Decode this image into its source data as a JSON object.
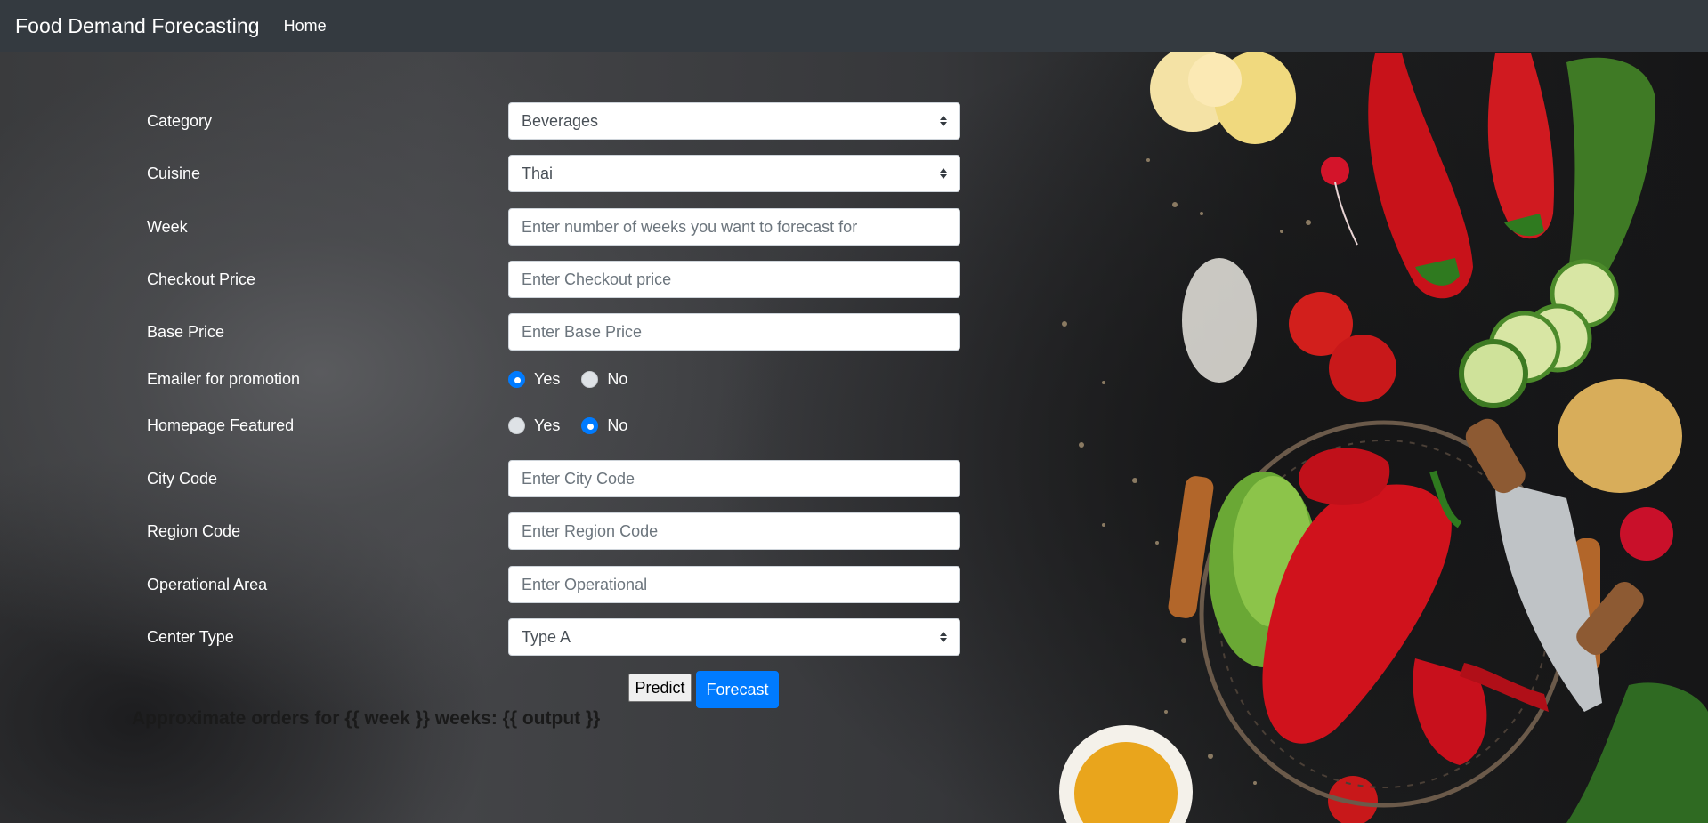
{
  "navbar": {
    "brand": "Food Demand Forecasting",
    "home": "Home"
  },
  "form": {
    "category": {
      "label": "Category",
      "value": "Beverages"
    },
    "cuisine": {
      "label": "Cuisine",
      "value": "Thai"
    },
    "week": {
      "label": "Week",
      "placeholder": "Enter number of weeks you want to forecast for"
    },
    "checkout_price": {
      "label": "Checkout Price",
      "placeholder": "Enter Checkout price"
    },
    "base_price": {
      "label": "Base Price",
      "placeholder": "Enter Base Price"
    },
    "emailer": {
      "label": "Emailer for promotion",
      "yes": "Yes",
      "no": "No",
      "selected": "Yes"
    },
    "homepage": {
      "label": "Homepage Featured",
      "yes": "Yes",
      "no": "No",
      "selected": "No"
    },
    "city_code": {
      "label": "City Code",
      "placeholder": "Enter City Code"
    },
    "region_code": {
      "label": "Region Code",
      "placeholder": "Enter Region Code"
    },
    "operational_area": {
      "label": "Operational Area",
      "placeholder": "Enter Operational"
    },
    "center_type": {
      "label": "Center Type",
      "value": "Type A"
    }
  },
  "buttons": {
    "predict": "Predict",
    "forecast": "Forecast"
  },
  "result": "Approximate orders for {{ week }} weeks: {{ output }}",
  "colors": {
    "navbar": "#343a40",
    "primary": "#007bff"
  }
}
